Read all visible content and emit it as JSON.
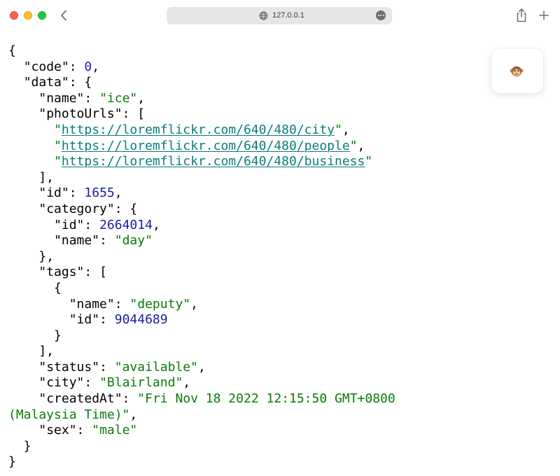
{
  "browser": {
    "url": "127.0.0.1",
    "icons": {
      "back": "chevron-left-icon",
      "globe": "globe-icon",
      "more": "ellipsis-icon",
      "share": "share-icon",
      "new_tab": "plus-icon",
      "extension": "monkey-face-icon"
    }
  },
  "json_lines": [
    [
      {
        "t": "p",
        "v": "{"
      }
    ],
    [
      {
        "t": "p",
        "v": "  "
      },
      {
        "t": "k",
        "v": "\"code\""
      },
      {
        "t": "p",
        "v": ": "
      },
      {
        "t": "n",
        "v": "0"
      },
      {
        "t": "p",
        "v": ","
      }
    ],
    [
      {
        "t": "p",
        "v": "  "
      },
      {
        "t": "k",
        "v": "\"data\""
      },
      {
        "t": "p",
        "v": ": {"
      }
    ],
    [
      {
        "t": "p",
        "v": "    "
      },
      {
        "t": "k",
        "v": "\"name\""
      },
      {
        "t": "p",
        "v": ": "
      },
      {
        "t": "s",
        "v": "\"ice\""
      },
      {
        "t": "p",
        "v": ","
      }
    ],
    [
      {
        "t": "p",
        "v": "    "
      },
      {
        "t": "k",
        "v": "\"photoUrls\""
      },
      {
        "t": "p",
        "v": ": ["
      }
    ],
    [
      {
        "t": "p",
        "v": "      "
      },
      {
        "t": "s",
        "v": "\""
      },
      {
        "t": "l",
        "v": "https://loremflickr.com/640/480/city"
      },
      {
        "t": "s",
        "v": "\""
      },
      {
        "t": "p",
        "v": ","
      }
    ],
    [
      {
        "t": "p",
        "v": "      "
      },
      {
        "t": "s",
        "v": "\""
      },
      {
        "t": "l",
        "v": "https://loremflickr.com/640/480/people"
      },
      {
        "t": "s",
        "v": "\""
      },
      {
        "t": "p",
        "v": ","
      }
    ],
    [
      {
        "t": "p",
        "v": "      "
      },
      {
        "t": "s",
        "v": "\""
      },
      {
        "t": "l",
        "v": "https://loremflickr.com/640/480/business"
      },
      {
        "t": "s",
        "v": "\""
      }
    ],
    [
      {
        "t": "p",
        "v": "    ],"
      }
    ],
    [
      {
        "t": "p",
        "v": "    "
      },
      {
        "t": "k",
        "v": "\"id\""
      },
      {
        "t": "p",
        "v": ": "
      },
      {
        "t": "n",
        "v": "1655"
      },
      {
        "t": "p",
        "v": ","
      }
    ],
    [
      {
        "t": "p",
        "v": "    "
      },
      {
        "t": "k",
        "v": "\"category\""
      },
      {
        "t": "p",
        "v": ": {"
      }
    ],
    [
      {
        "t": "p",
        "v": "      "
      },
      {
        "t": "k",
        "v": "\"id\""
      },
      {
        "t": "p",
        "v": ": "
      },
      {
        "t": "n",
        "v": "2664014"
      },
      {
        "t": "p",
        "v": ","
      }
    ],
    [
      {
        "t": "p",
        "v": "      "
      },
      {
        "t": "k",
        "v": "\"name\""
      },
      {
        "t": "p",
        "v": ": "
      },
      {
        "t": "s",
        "v": "\"day\""
      }
    ],
    [
      {
        "t": "p",
        "v": "    },"
      }
    ],
    [
      {
        "t": "p",
        "v": "    "
      },
      {
        "t": "k",
        "v": "\"tags\""
      },
      {
        "t": "p",
        "v": ": ["
      }
    ],
    [
      {
        "t": "p",
        "v": "      {"
      }
    ],
    [
      {
        "t": "p",
        "v": "        "
      },
      {
        "t": "k",
        "v": "\"name\""
      },
      {
        "t": "p",
        "v": ": "
      },
      {
        "t": "s",
        "v": "\"deputy\""
      },
      {
        "t": "p",
        "v": ","
      }
    ],
    [
      {
        "t": "p",
        "v": "        "
      },
      {
        "t": "k",
        "v": "\"id\""
      },
      {
        "t": "p",
        "v": ": "
      },
      {
        "t": "n",
        "v": "9044689"
      }
    ],
    [
      {
        "t": "p",
        "v": "      }"
      }
    ],
    [
      {
        "t": "p",
        "v": "    ],"
      }
    ],
    [
      {
        "t": "p",
        "v": "    "
      },
      {
        "t": "k",
        "v": "\"status\""
      },
      {
        "t": "p",
        "v": ": "
      },
      {
        "t": "s",
        "v": "\"available\""
      },
      {
        "t": "p",
        "v": ","
      }
    ],
    [
      {
        "t": "p",
        "v": "    "
      },
      {
        "t": "k",
        "v": "\"city\""
      },
      {
        "t": "p",
        "v": ": "
      },
      {
        "t": "s",
        "v": "\"Blairland\""
      },
      {
        "t": "p",
        "v": ","
      }
    ],
    [
      {
        "t": "p",
        "v": "    "
      },
      {
        "t": "k",
        "v": "\"createdAt\""
      },
      {
        "t": "p",
        "v": ": "
      },
      {
        "t": "s",
        "v": "\"Fri Nov 18 2022 12:15:50 GMT+0800"
      }
    ],
    [
      {
        "t": "s",
        "v": "(Malaysia Time)\""
      },
      {
        "t": "p",
        "v": ","
      }
    ],
    [
      {
        "t": "p",
        "v": "    "
      },
      {
        "t": "k",
        "v": "\"sex\""
      },
      {
        "t": "p",
        "v": ": "
      },
      {
        "t": "s",
        "v": "\"male\""
      }
    ],
    [
      {
        "t": "p",
        "v": "  }"
      }
    ],
    [
      {
        "t": "p",
        "v": "}"
      }
    ]
  ],
  "colors": {
    "key": "#000000",
    "string": "#0b7a0b",
    "number": "#1c1ca8",
    "link": "#0a7c7c",
    "close": "#ff5f57",
    "minimize": "#febc2e",
    "maximize": "#28c840"
  }
}
